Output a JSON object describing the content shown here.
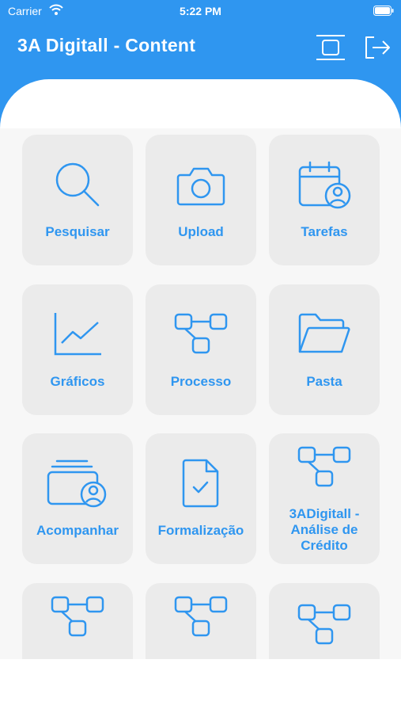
{
  "status": {
    "carrier": "Carrier",
    "time": "5:22 PM"
  },
  "header": {
    "title": "3A Digitall - Content"
  },
  "tiles": [
    {
      "label": "Pesquisar",
      "icon": "search-icon"
    },
    {
      "label": "Upload",
      "icon": "camera-icon"
    },
    {
      "label": "Tarefas",
      "icon": "calendar-user-icon"
    },
    {
      "label": "Gráficos",
      "icon": "line-chart-icon"
    },
    {
      "label": "Processo",
      "icon": "workflow-icon"
    },
    {
      "label": "Pasta",
      "icon": "folder-open-icon"
    },
    {
      "label": "Acompanhar",
      "icon": "cards-user-icon"
    },
    {
      "label": "Formalização",
      "icon": "document-check-icon"
    },
    {
      "label": "3ADigitall - Análise de Crédito",
      "icon": "workflow-icon"
    },
    {
      "label": "",
      "icon": "workflow-icon"
    },
    {
      "label": "",
      "icon": "workflow-icon"
    },
    {
      "label": "",
      "icon": "workflow-icon"
    }
  ],
  "colors": {
    "accent": "#2f96f0",
    "tile_bg": "#ebebeb",
    "grid_bg": "#f7f7f7"
  }
}
